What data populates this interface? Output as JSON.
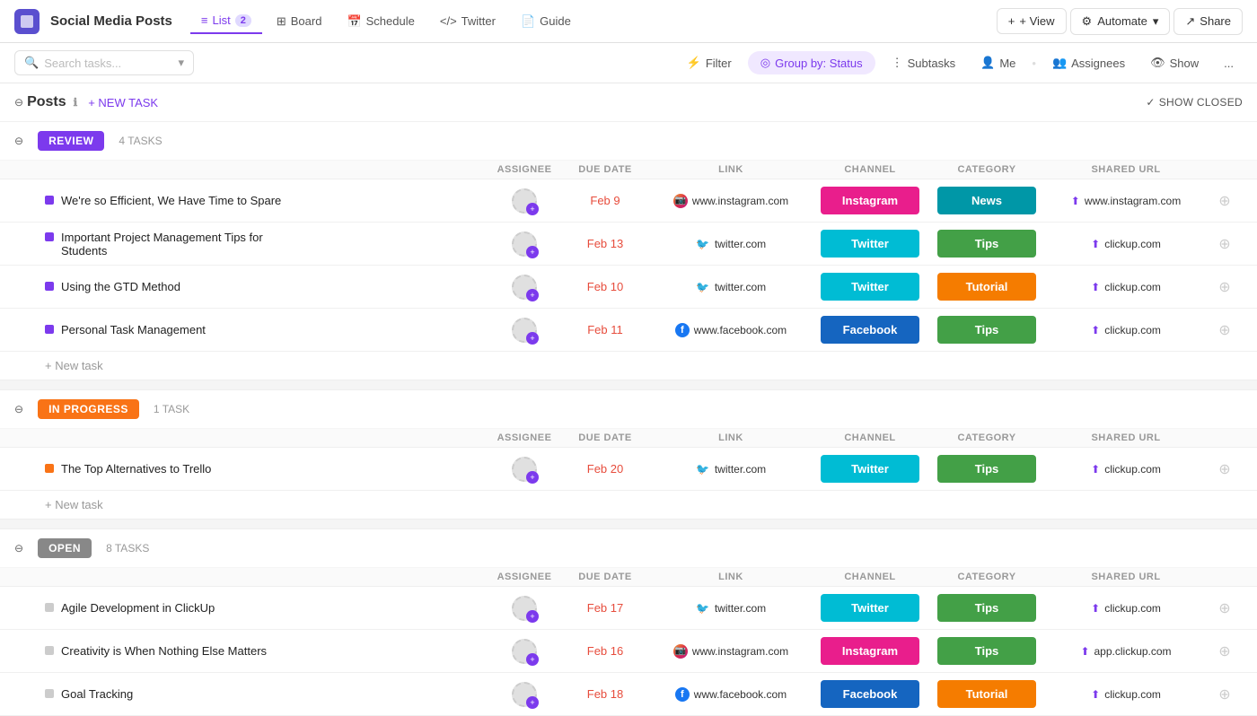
{
  "app": {
    "icon_label": "grid-icon",
    "title": "Social Media Posts"
  },
  "nav": {
    "tabs": [
      {
        "id": "list",
        "icon": "≡",
        "label": "List",
        "badge": "2",
        "active": true
      },
      {
        "id": "board",
        "icon": "⊞",
        "label": "Board",
        "badge": null,
        "active": false
      },
      {
        "id": "schedule",
        "icon": "📅",
        "label": "Schedule",
        "badge": null,
        "active": false
      },
      {
        "id": "twitter",
        "icon": "</>",
        "label": "Twitter",
        "badge": null,
        "active": false
      },
      {
        "id": "guide",
        "icon": "📄",
        "label": "Guide",
        "badge": null,
        "active": false
      }
    ],
    "view_btn": "+ View",
    "automate_btn": "Automate",
    "share_btn": "Share"
  },
  "toolbar": {
    "search_placeholder": "Search tasks...",
    "filter_btn": "Filter",
    "group_by_btn": "Group by: Status",
    "subtasks_btn": "Subtasks",
    "me_btn": "Me",
    "assignees_btn": "Assignees",
    "show_btn": "Show",
    "more_btn": "..."
  },
  "section": {
    "title": "Posts",
    "new_task_btn": "+ NEW TASK",
    "show_closed_btn": "SHOW CLOSED"
  },
  "status_groups": [
    {
      "id": "review",
      "label": "REVIEW",
      "task_count": "4 TASKS",
      "col_headers": [
        "ASSIGNEE",
        "DUE DATE",
        "LINK",
        "CHANNEL",
        "CATEGORY",
        "SHARED URL"
      ],
      "tasks": [
        {
          "name": "We're so Efficient, We Have Time to Spare",
          "dot_color": "purple",
          "due_date": "Feb 9",
          "link_type": "instagram",
          "link_text": "www.instagram.com",
          "channel": "Instagram",
          "channel_color": "instagram",
          "category": "News",
          "category_color": "news",
          "shared_url_icon": "instagram",
          "shared_url": "www.instagram.com"
        },
        {
          "name": "Important Project Management Tips for Students",
          "dot_color": "purple",
          "due_date": "Feb 13",
          "link_type": "twitter",
          "link_text": "twitter.com",
          "channel": "Twitter",
          "channel_color": "twitter",
          "category": "Tips",
          "category_color": "tips",
          "shared_url_icon": "clickup",
          "shared_url": "clickup.com"
        },
        {
          "name": "Using the GTD Method",
          "dot_color": "purple",
          "due_date": "Feb 10",
          "link_type": "twitter",
          "link_text": "twitter.com",
          "channel": "Twitter",
          "channel_color": "twitter",
          "category": "Tutorial",
          "category_color": "tutorial",
          "shared_url_icon": "clickup",
          "shared_url": "clickup.com"
        },
        {
          "name": "Personal Task Management",
          "dot_color": "purple",
          "due_date": "Feb 11",
          "link_type": "facebook",
          "link_text": "www.facebook.com",
          "channel": "Facebook",
          "channel_color": "facebook",
          "category": "Tips",
          "category_color": "tips",
          "shared_url_icon": "clickup",
          "shared_url": "clickup.com"
        }
      ]
    },
    {
      "id": "in-progress",
      "label": "IN PROGRESS",
      "task_count": "1 TASK",
      "col_headers": [
        "ASSIGNEE",
        "DUE DATE",
        "LINK",
        "CHANNEL",
        "CATEGORY",
        "SHARED URL"
      ],
      "tasks": [
        {
          "name": "The Top Alternatives to Trello",
          "dot_color": "orange",
          "due_date": "Feb 20",
          "link_type": "twitter",
          "link_text": "twitter.com",
          "channel": "Twitter",
          "channel_color": "twitter",
          "category": "Tips",
          "category_color": "tips",
          "shared_url_icon": "clickup",
          "shared_url": "clickup.com"
        }
      ]
    },
    {
      "id": "open",
      "label": "OPEN",
      "task_count": "8 TASKS",
      "col_headers": [
        "ASSIGNEE",
        "DUE DATE",
        "LINK",
        "CHANNEL",
        "CATEGORY",
        "SHARED URL"
      ],
      "tasks": [
        {
          "name": "Agile Development in ClickUp",
          "dot_color": "gray",
          "due_date": "Feb 17",
          "link_type": "twitter",
          "link_text": "twitter.com",
          "channel": "Twitter",
          "channel_color": "twitter",
          "category": "Tips",
          "category_color": "tips",
          "shared_url_icon": "clickup",
          "shared_url": "clickup.com"
        },
        {
          "name": "Creativity is When Nothing Else Matters",
          "dot_color": "gray",
          "due_date": "Feb 16",
          "link_type": "instagram",
          "link_text": "www.instagram.com",
          "channel": "Instagram",
          "channel_color": "instagram",
          "category": "Tips",
          "category_color": "tips",
          "shared_url_icon": "instagram",
          "shared_url": "app.clickup.com"
        },
        {
          "name": "Goal Tracking",
          "dot_color": "gray",
          "due_date": "Feb 18",
          "link_type": "facebook",
          "link_text": "www.facebook.com",
          "channel": "Facebook",
          "channel_color": "facebook",
          "category": "Tutorial",
          "category_color": "tutorial",
          "shared_url_icon": "clickup",
          "shared_url": "clickup.com"
        }
      ]
    }
  ],
  "icons": {
    "instagram": "📷",
    "twitter": "🐦",
    "facebook": "f",
    "clickup": "⬆"
  }
}
